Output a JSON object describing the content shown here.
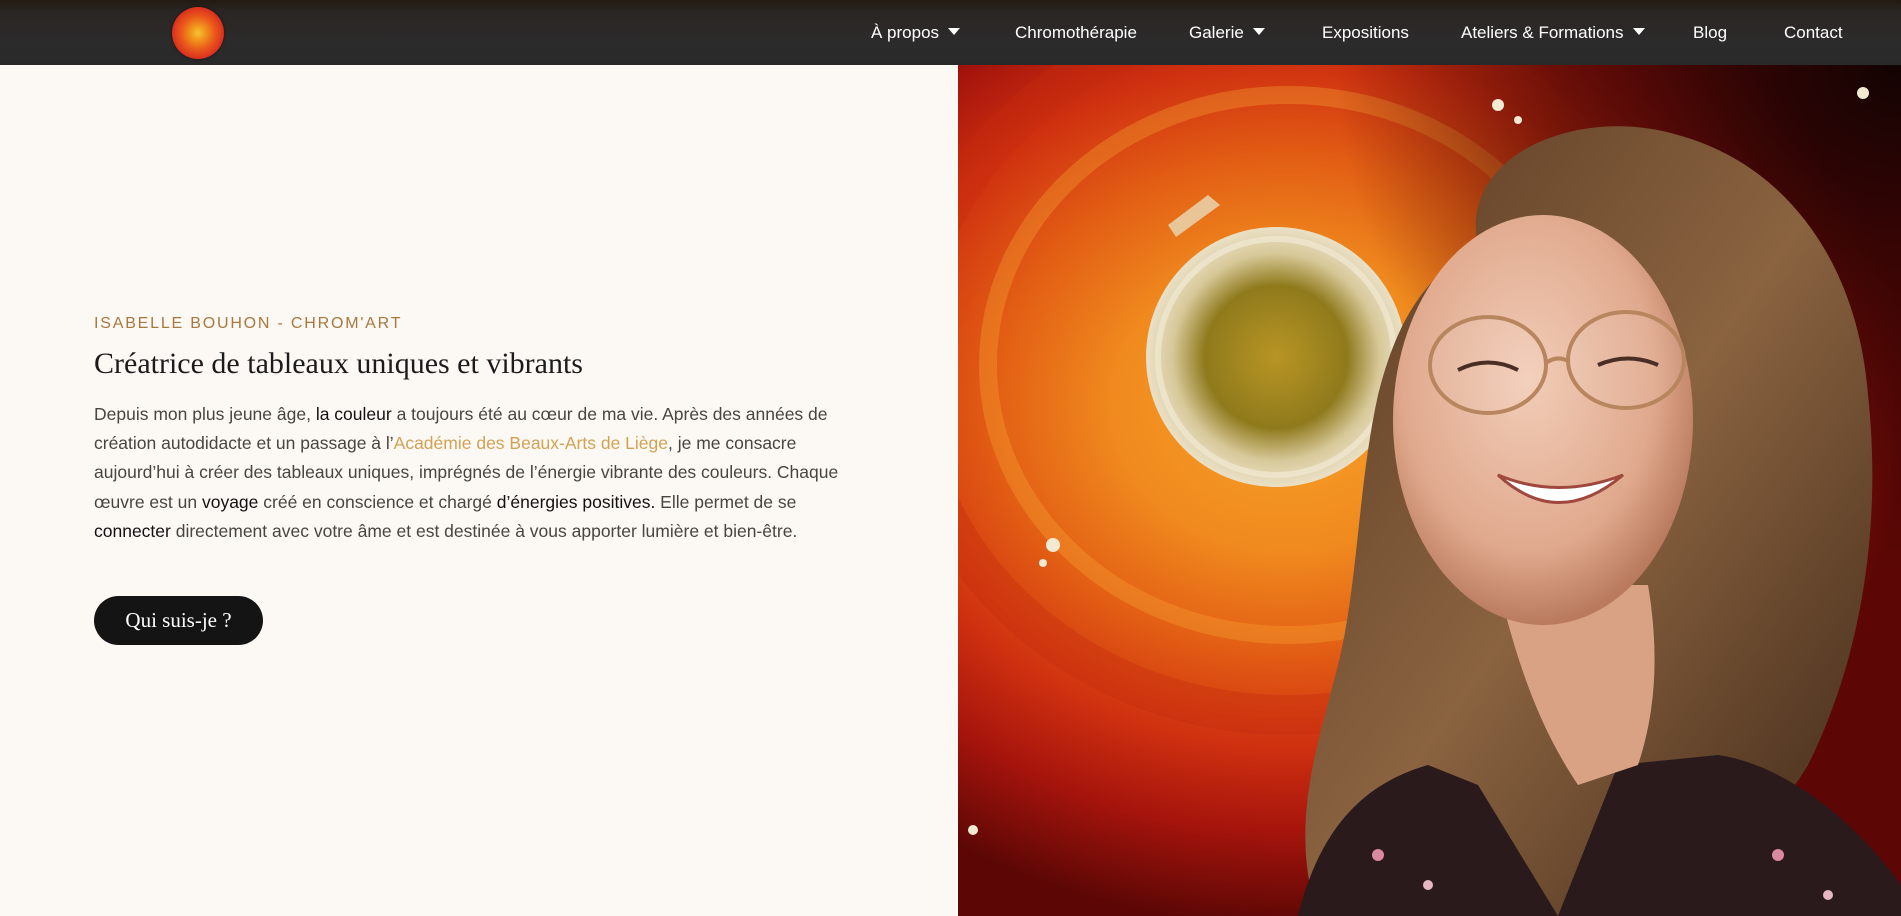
{
  "header": {
    "nav": [
      {
        "label": "À propos",
        "dropdown": true
      },
      {
        "label": "Chromothérapie",
        "dropdown": false
      },
      {
        "label": "Galerie",
        "dropdown": true
      },
      {
        "label": "Expositions",
        "dropdown": false
      },
      {
        "label": "Ateliers & Formations",
        "dropdown": true
      },
      {
        "label": "Blog",
        "dropdown": false
      },
      {
        "label": "Contact",
        "dropdown": false
      }
    ]
  },
  "hero": {
    "eyebrow": "ISABELLE BOUHON - CHROM'ART",
    "title": "Créatrice de tableaux uniques et vibrants",
    "body": [
      {
        "t": "Depuis mon plus jeune âge, ",
        "s": "normal"
      },
      {
        "t": "la couleur",
        "s": "strong"
      },
      {
        "t": " a toujours été au cœur de ma vie. Après des années de création autodidacte et un passage à l’",
        "s": "normal"
      },
      {
        "t": "Académie des Beaux-Arts de Liège",
        "s": "link"
      },
      {
        "t": ", je me consacre aujourd’hui à créer des tableaux uniques, imprégnés de l’énergie vibrante des couleurs. Chaque œuvre est un ",
        "s": "normal"
      },
      {
        "t": "voyage",
        "s": "strong"
      },
      {
        "t": " créé en conscience et chargé ",
        "s": "normal"
      },
      {
        "t": "d’énergies positives.",
        "s": "strong"
      },
      {
        "t": " Elle permet de se ",
        "s": "normal"
      },
      {
        "t": "connecter",
        "s": "strong"
      },
      {
        "t": " directement avec votre âme et est destinée à vous apporter lumière et bien-être.",
        "s": "normal"
      }
    ],
    "cta_label": "Qui suis-je ?"
  },
  "colors": {
    "header_bg": "#2c2b2b",
    "page_bg": "#fcf9f5",
    "eyebrow": "#a8783e",
    "link": "#d2a154",
    "button_bg": "#141414"
  },
  "icons": {
    "logo": "orange-red-sphere-logo",
    "dropdown": "caret-down-icon"
  }
}
